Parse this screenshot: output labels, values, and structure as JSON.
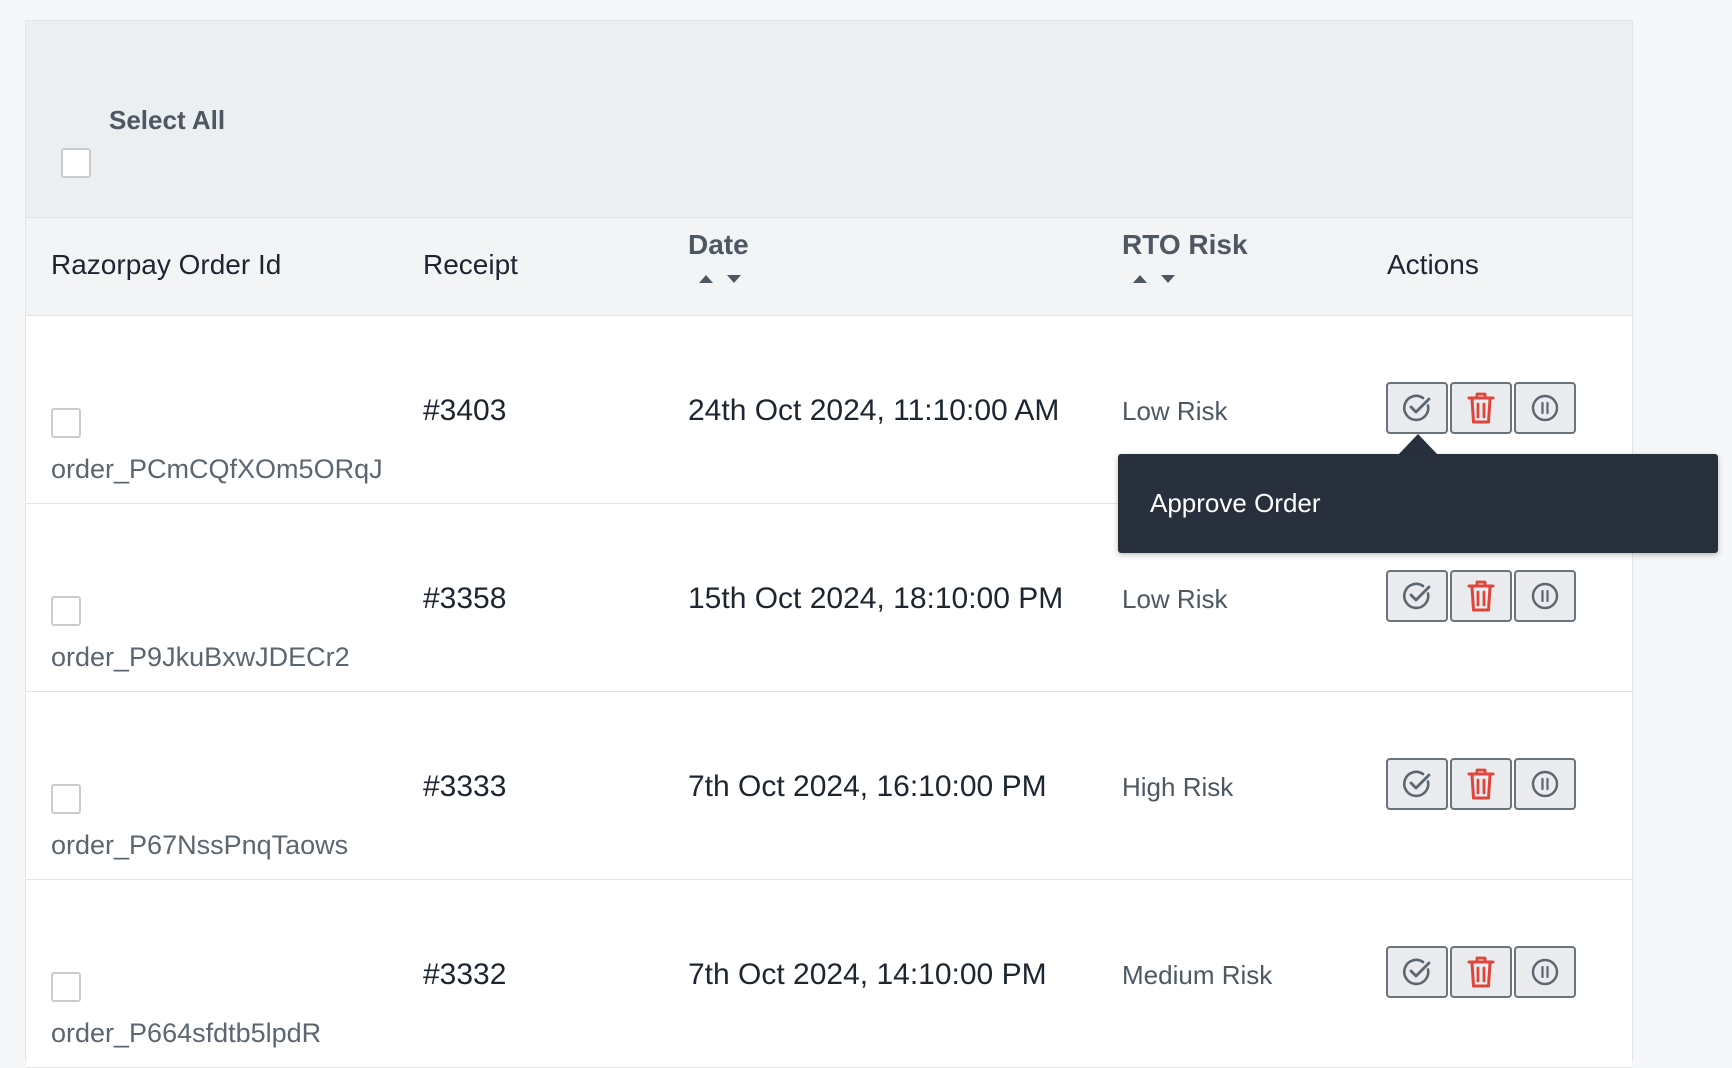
{
  "select_all_label": "Select All",
  "columns": {
    "order_id": "Razorpay Order Id",
    "receipt": "Receipt",
    "date": "Date",
    "rto_risk": "RTO Risk",
    "actions": "Actions"
  },
  "rows": [
    {
      "order_id": "order_PCmCQfXOm5ORqJ",
      "receipt": "#3403",
      "date": "24th Oct 2024, 11:10:00 AM",
      "risk": "Low Risk"
    },
    {
      "order_id": "order_P9JkuBxwJDECr2",
      "receipt": "#3358",
      "date": "15th Oct 2024, 18:10:00 PM",
      "risk": "Low Risk"
    },
    {
      "order_id": "order_P67NssPnqTaows",
      "receipt": "#3333",
      "date": "7th Oct 2024, 16:10:00 PM",
      "risk": "High Risk"
    },
    {
      "order_id": "order_P664sfdtb5lpdR",
      "receipt": "#3332",
      "date": "7th Oct 2024, 14:10:00 PM",
      "risk": "Medium Risk"
    }
  ],
  "actions": [
    {
      "name": "approve",
      "icon": "check-circle-icon"
    },
    {
      "name": "delete",
      "icon": "trash-icon"
    },
    {
      "name": "hold",
      "icon": "pause-circle-icon"
    }
  ],
  "tooltip": {
    "text": "Approve Order"
  },
  "colors": {
    "delete_icon": "#e0453a",
    "action_icon": "#5b6670",
    "tooltip_bg": "#29303d"
  }
}
